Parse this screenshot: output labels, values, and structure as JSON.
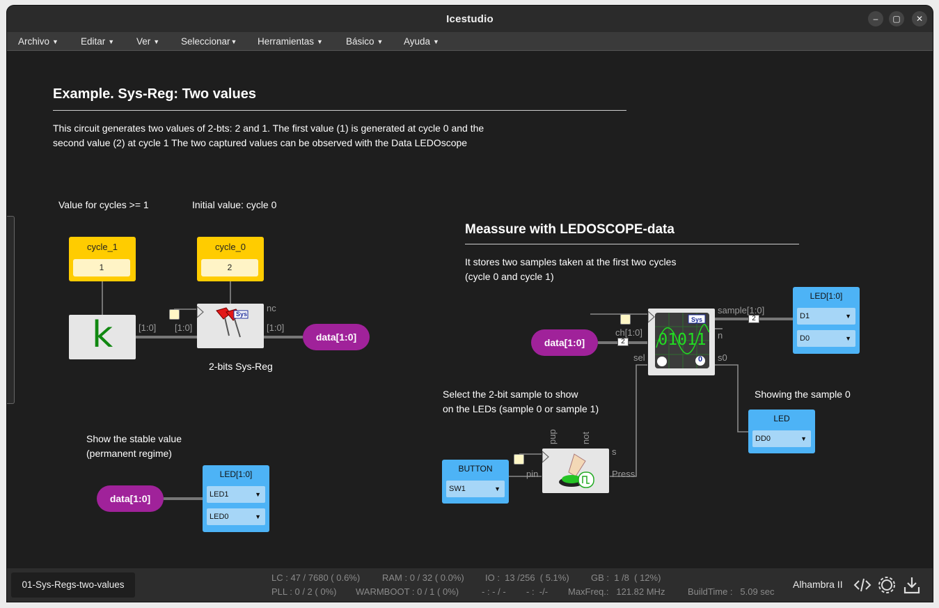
{
  "window": {
    "title": "Icestudio",
    "controls": [
      "–",
      "▢",
      "✕"
    ]
  },
  "menu": [
    {
      "label": "Archivo"
    },
    {
      "label": "Editar"
    },
    {
      "label": "Ver"
    },
    {
      "label": "Seleccionar"
    },
    {
      "label": "Herramientas"
    },
    {
      "label": "Básico"
    },
    {
      "label": "Ayuda"
    }
  ],
  "doc": {
    "title": "Example. Sys-Reg: Two values",
    "desc_line1": "This circuit generates two values of 2-bts: 2 and 1. The first value (1) is generated at cycle 0 and the",
    "desc_line2": "second value (2) at cycle 1 The two captured values can be observed with the Data LEDOscope",
    "note_cycles": "Value for cycles >= 1",
    "note_initial": "Initial value: cycle 0",
    "note_stable1": "Show the stable value",
    "note_stable2": "(permanent regime)",
    "measure_title": "Meassure with LEDOSCOPE-data",
    "measure_line1": "It stores two samples taken at the first two cycles",
    "measure_line2": "(cycle 0 and cycle 1)",
    "select_line1": "Select the 2-bit sample to show",
    "select_line2": "on the LEDs (sample 0 or sample 1)",
    "showing": "Showing the sample 0"
  },
  "blocks": {
    "cycle1": {
      "name": "cycle_1",
      "value": "1"
    },
    "cycle0": {
      "name": "cycle_0",
      "value": "2"
    },
    "k_symbol": "k",
    "sysreg_label": "2-bits Sys-Reg",
    "sys_badge": "Sys",
    "data_pill": "data[1:0]",
    "led_main": {
      "name": "LED[1:0]",
      "sel1": "D1",
      "sel2": "D0"
    },
    "led_stable": {
      "name": "LED[1:0]",
      "sel1": "LED1",
      "sel2": "LED0"
    },
    "led_single": {
      "name": "LED",
      "sel1": "DD0"
    },
    "button": {
      "name": "BUTTON",
      "sel1": "SW1"
    },
    "scope_digits": "01011",
    "scope_zero": "0"
  },
  "wires": {
    "bus1": "[1:0]",
    "bus2": "[1:0]",
    "bus3": "[1:0]",
    "nc": "nc",
    "sample": "sample[1:0]",
    "ch": "ch[1:0]",
    "n": "n",
    "sel": "sel",
    "s0": "s0",
    "pup": "pup",
    "not": "not",
    "s": "s",
    "pin": "pin",
    "press": "Press",
    "tag2": "2"
  },
  "status": {
    "tab": "01-Sys-Regs-two-values",
    "lc": "LC : 47 / 7680 ( 0.6%)",
    "ram": "RAM : 0 / 32 ( 0.0%)",
    "io": "IO :  13 /256  ( 5.1%)",
    "gb": "GB :  1 /8  ( 12%)",
    "pll": "PLL : 0 / 2 ( 0%)",
    "warmboot": "WARMBOOT : 0 / 1 ( 0%)",
    "dash1": "- : - / -",
    "dash2": "- :  -/-",
    "maxfreq": "MaxFreq.:   121.82 MHz",
    "buildtime": "BuildTime :   5.09 sec",
    "board": "Alhambra II"
  },
  "colors": {
    "constant": "#ffcc00",
    "led": "#4db3f6",
    "pill": "#a0229a",
    "canvas": "#1e1e1e"
  }
}
